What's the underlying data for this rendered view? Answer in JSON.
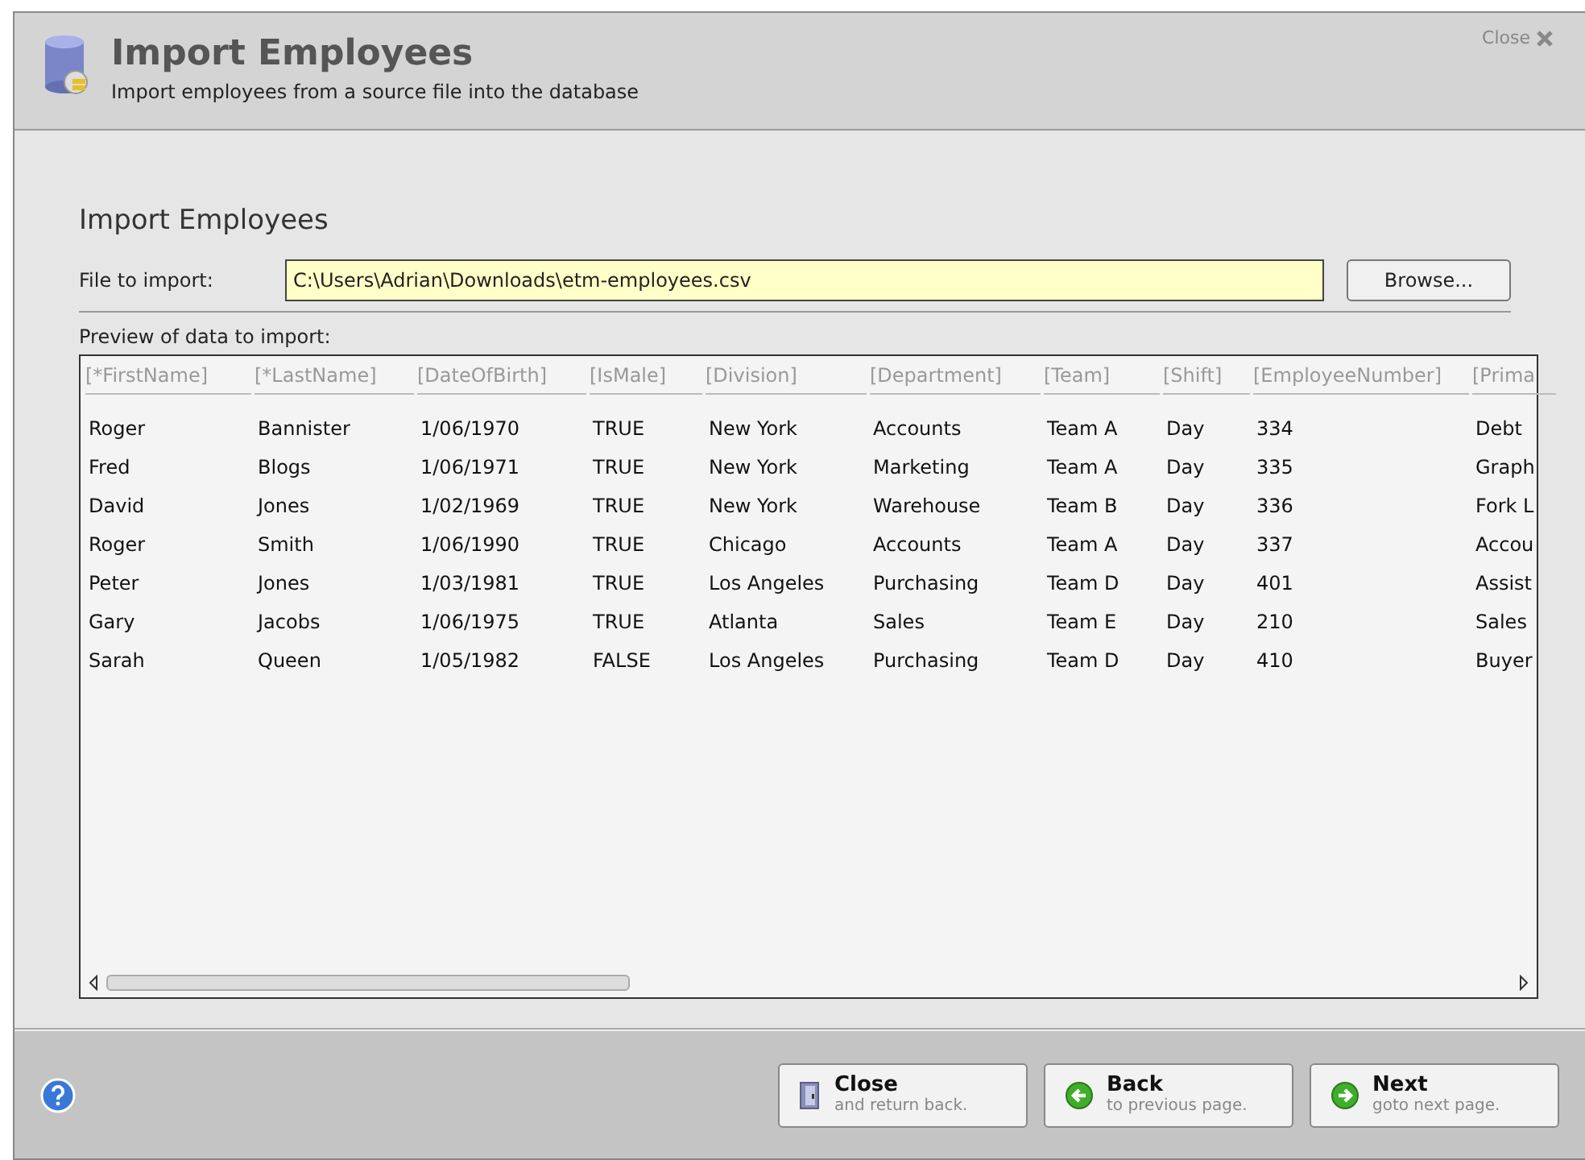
{
  "window": {
    "title": "Import Employees",
    "subtitle": "Import employees from a source file into the database",
    "close_label": "Close"
  },
  "section_title": "Import Employees",
  "file_field": {
    "label": "File to import:",
    "value": "C:\\Users\\Adrian\\Downloads\\etm-employees.csv",
    "browse_button": "Browse..."
  },
  "preview_label": "Preview of data to import:",
  "table": {
    "columns": [
      "[*FirstName]",
      "[*LastName]",
      "[DateOfBirth]",
      "[IsMale]",
      "[Division]",
      "[Department]",
      "[Team]",
      "[Shift]",
      "[EmployeeNumber]",
      "[Prima"
    ],
    "rows": [
      [
        "Roger",
        "Bannister",
        "1/06/1970",
        "TRUE",
        "New York",
        "Accounts",
        "Team A",
        "Day",
        "334",
        "Debt"
      ],
      [
        "Fred",
        "Blogs",
        "1/06/1971",
        "TRUE",
        "New York",
        "Marketing",
        "Team A",
        "Day",
        "335",
        "Graph"
      ],
      [
        "David",
        "Jones",
        "1/02/1969",
        "TRUE",
        "New York",
        "Warehouse",
        "Team B",
        "Day",
        "336",
        "Fork L"
      ],
      [
        "Roger",
        "Smith",
        "1/06/1990",
        "TRUE",
        "Chicago",
        "Accounts",
        "Team A",
        "Day",
        "337",
        "Accou"
      ],
      [
        "Peter",
        "Jones",
        "1/03/1981",
        "TRUE",
        "Los Angeles",
        "Purchasing",
        "Team D",
        "Day",
        "401",
        "Assist"
      ],
      [
        "Gary",
        "Jacobs",
        "1/06/1975",
        "TRUE",
        "Atlanta",
        "Sales",
        "Team E",
        "Day",
        "210",
        "Sales"
      ],
      [
        "Sarah",
        "Queen",
        "1/05/1982",
        "FALSE",
        "Los Angeles",
        "Purchasing",
        "Team D",
        "Day",
        "410",
        "Buyer"
      ]
    ]
  },
  "footer": {
    "buttons": [
      {
        "kind": "close",
        "label": "Close",
        "sublabel": "and return back."
      },
      {
        "kind": "back",
        "label": "Back",
        "sublabel": "to previous page."
      },
      {
        "kind": "next",
        "label": "Next",
        "sublabel": "goto next page."
      }
    ]
  }
}
